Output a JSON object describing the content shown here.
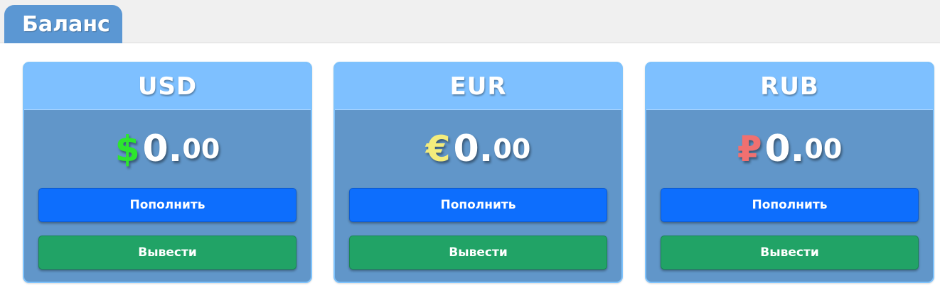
{
  "tab": {
    "label": "Баланс"
  },
  "cards": [
    {
      "currency": "USD",
      "symbol": "$",
      "amount_int": "0.",
      "amount_dec": "00",
      "symbol_color": "#2de62d",
      "deposit_label": "Пополнить",
      "withdraw_label": "Вывести"
    },
    {
      "currency": "EUR",
      "symbol": "€",
      "amount_int": "0.",
      "amount_dec": "00",
      "symbol_color": "#f4ec7c",
      "deposit_label": "Пополнить",
      "withdraw_label": "Вывести"
    },
    {
      "currency": "RUB",
      "symbol": "₽",
      "amount_int": "0.",
      "amount_dec": "00",
      "symbol_color": "#f07070",
      "deposit_label": "Пополнить",
      "withdraw_label": "Вывести"
    }
  ],
  "colors": {
    "tab": "#5b97d3",
    "card_body": "#6196c9",
    "card_header": "#7ec0ff",
    "deposit_button": "#0d6efd",
    "withdraw_button": "#21a366"
  }
}
